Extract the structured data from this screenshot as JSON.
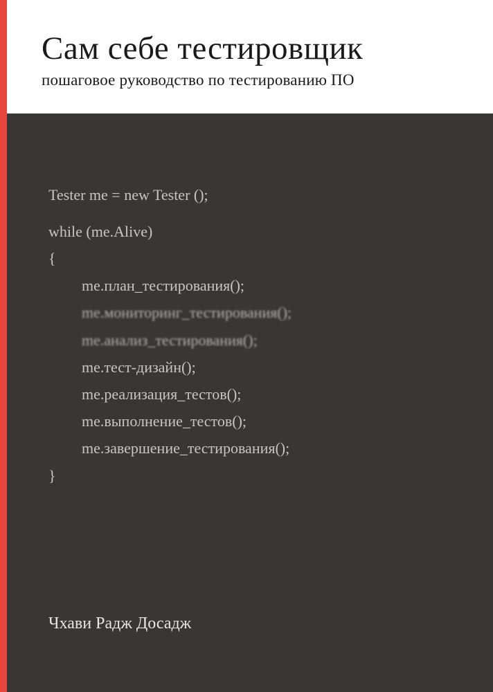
{
  "header": {
    "title": "Сам себе тестировщик",
    "subtitle": "пошаговое руководство по тестированию ПО"
  },
  "code": {
    "line1": "Tester me = new Tester ();",
    "line2": "while (me.Alive)",
    "brace_open": "{",
    "methods": [
      "me.план_тестирования();",
      "me.мониторинг_тестирования();",
      "me.анализ_тестирования();",
      "me.тест-дизайн();",
      "me.реализация_тестов();",
      "me.выполнение_тестов();",
      "me.завершение_тестирования();"
    ],
    "brace_close": "}"
  },
  "author": "Чхави Радж Досадж"
}
